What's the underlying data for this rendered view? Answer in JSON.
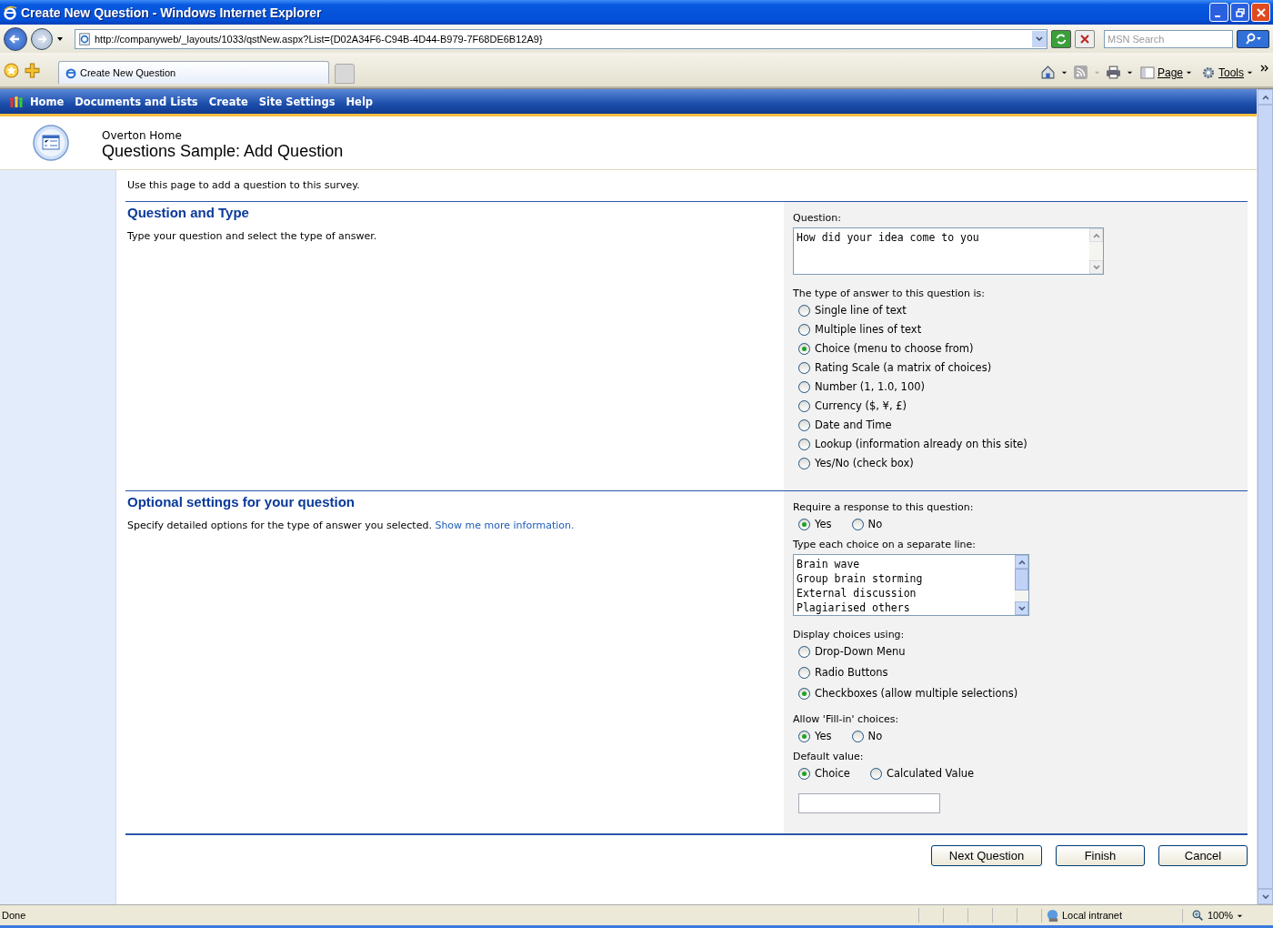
{
  "window": {
    "title": "Create New Question - Windows Internet Explorer"
  },
  "browser": {
    "address": "http://companyweb/_layouts/1033/qstNew.aspx?List={D02A34F6-C94B-4D44-B979-7F68DE6B12A9}",
    "search": {
      "placeholder": "MSN Search"
    },
    "tab": {
      "label": "Create New Question"
    },
    "commands": [
      "Page",
      "Tools"
    ]
  },
  "nav": {
    "items": [
      "Home",
      "Documents and Lists",
      "Create",
      "Site Settings",
      "Help"
    ]
  },
  "header": {
    "site": "Overton Home",
    "title": "Questions Sample: Add Question"
  },
  "intro": "Use this page to add a question to this survey.",
  "question_section": {
    "title": "Question and Type",
    "description": "Type your question and select the type of answer.",
    "question": {
      "label": "Question:",
      "value": "How did your idea come to you"
    },
    "answer_type": {
      "label": "The type of answer to this question is:",
      "options": [
        {
          "label": "Single line of text",
          "selected": false
        },
        {
          "label": "Multiple lines of text",
          "selected": false
        },
        {
          "label": "Choice (menu to choose from)",
          "selected": true
        },
        {
          "label": "Rating Scale (a matrix of choices)",
          "selected": false
        },
        {
          "label": "Number (1, 1.0, 100)",
          "selected": false
        },
        {
          "label": "Currency ($, ¥, £)",
          "selected": false
        },
        {
          "label": "Date and Time",
          "selected": false
        },
        {
          "label": "Lookup (information already on this site)",
          "selected": false
        },
        {
          "label": "Yes/No (check box)",
          "selected": false
        }
      ]
    }
  },
  "optional_section": {
    "title": "Optional settings for your question",
    "description": "Specify detailed options for the type of answer you selected.",
    "link": "Show me more information.",
    "require": {
      "label": "Require a response to this question:",
      "options": [
        {
          "label": "Yes",
          "selected": true
        },
        {
          "label": "No",
          "selected": false
        }
      ]
    },
    "choices": {
      "label": "Type each choice on a separate line:",
      "lines": [
        "Brain wave",
        "Group brain storming",
        "External discussion",
        "Plagiarised others"
      ]
    },
    "display": {
      "label": "Display choices using:",
      "options": [
        {
          "label": "Drop-Down Menu",
          "selected": false
        },
        {
          "label": "Radio Buttons",
          "selected": false
        },
        {
          "label": "Checkboxes (allow multiple selections)",
          "selected": true
        }
      ]
    },
    "fill_in": {
      "label": "Allow 'Fill-in' choices:",
      "options": [
        {
          "label": "Yes",
          "selected": true
        },
        {
          "label": "No",
          "selected": false
        }
      ]
    },
    "default_value": {
      "label": "Default value:",
      "options": [
        {
          "label": "Choice",
          "selected": true
        },
        {
          "label": "Calculated Value",
          "selected": false
        }
      ]
    }
  },
  "buttons": [
    "Next Question",
    "Finish",
    "Cancel"
  ],
  "status_bar": {
    "status": "Done",
    "zone": "Local intranet",
    "zoom": "100%"
  }
}
